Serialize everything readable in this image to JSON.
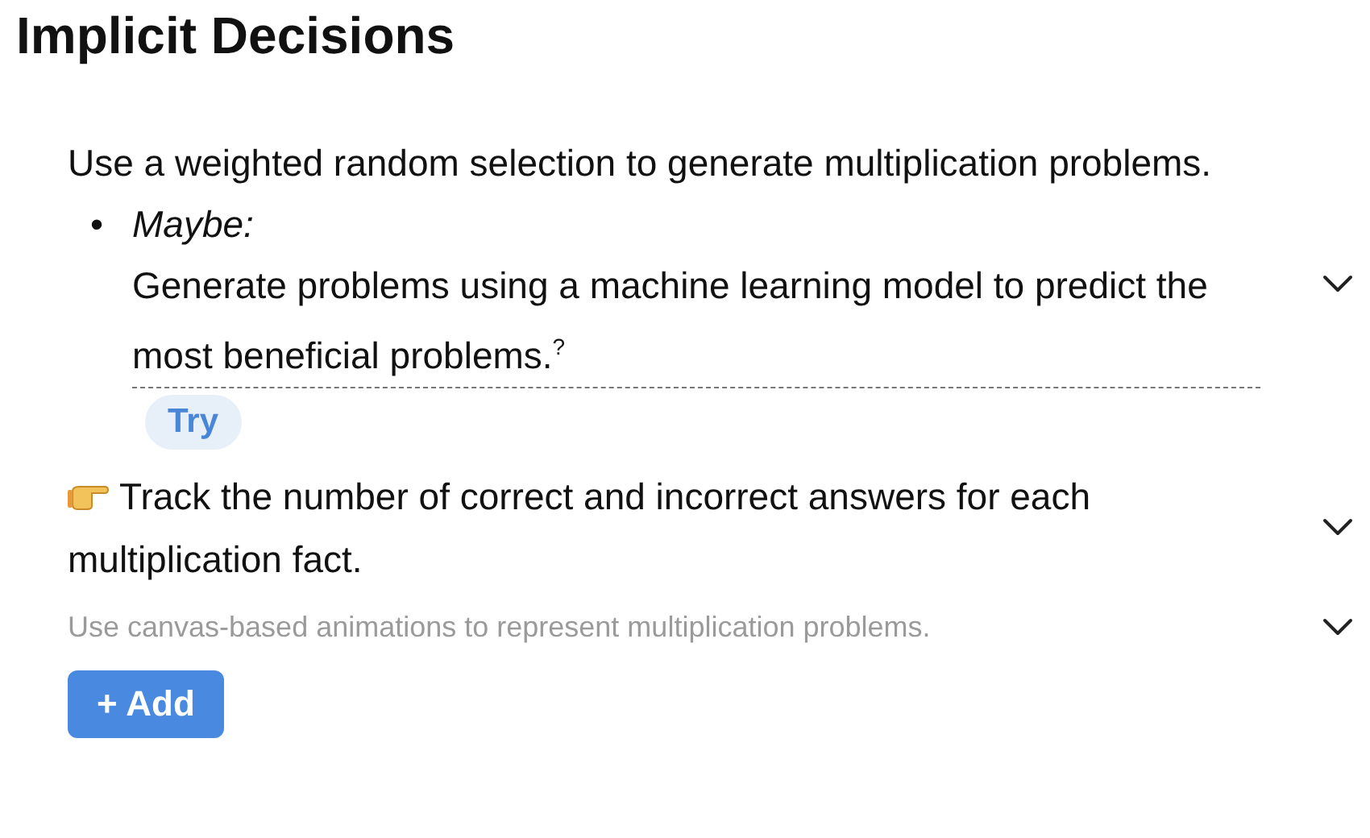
{
  "title": "Implicit Decisions",
  "decisions": [
    {
      "kind": "plain",
      "text": "Use a weighted random selection to generate multiplication problems.",
      "alternative": {
        "bullet": "•",
        "label": "Maybe:",
        "text": "Generate problems using a machine learning model to predict the most beneficial problems.$^{?}$",
        "action": "Try"
      }
    },
    {
      "kind": "chosen",
      "text": "Track the number of correct and incorrect answers for each multiplication fact."
    },
    {
      "kind": "muted",
      "text": "Use canvas-based animations to represent multiplication problems."
    }
  ],
  "add_button": "+ Add"
}
